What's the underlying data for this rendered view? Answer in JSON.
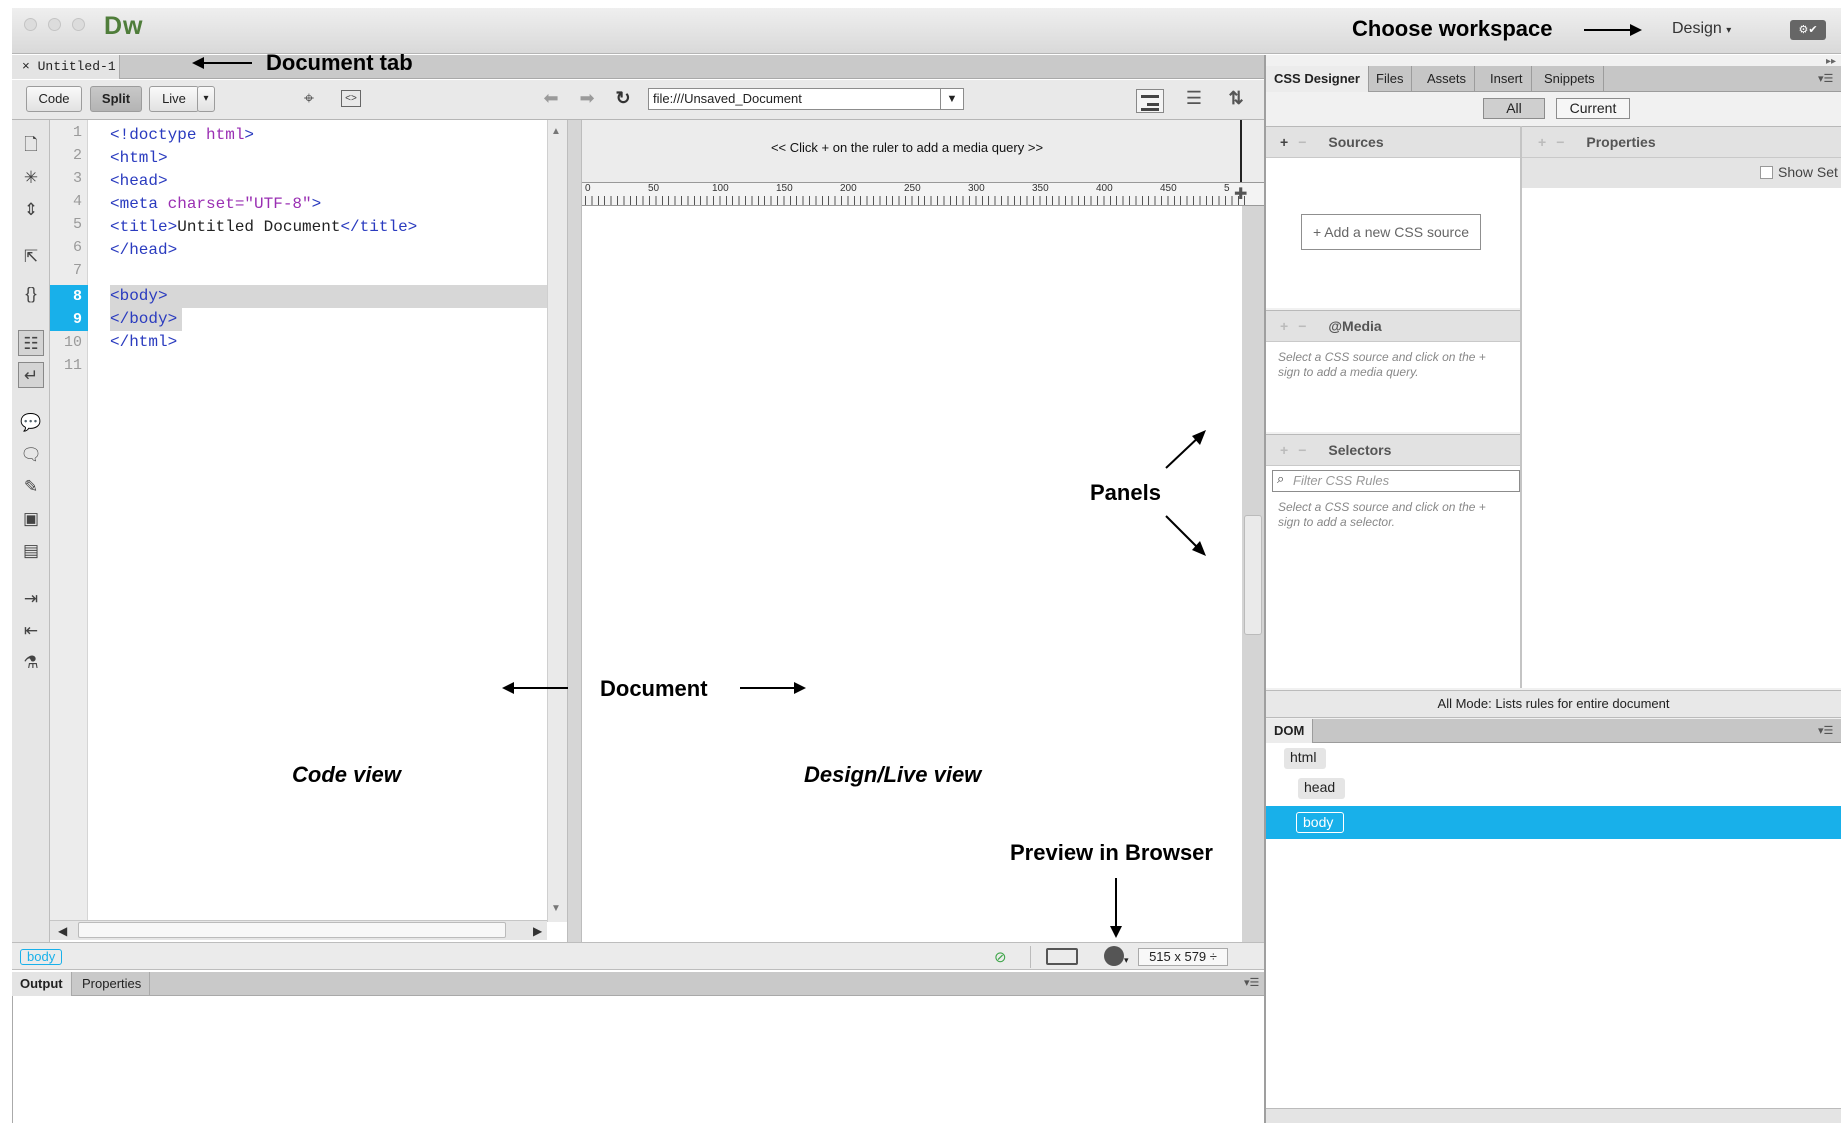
{
  "app": {
    "logo": "Dw",
    "workspace_label": "Design",
    "workspace_caret": "▾"
  },
  "annotations": {
    "choose_workspace": "Choose workspace",
    "document_tab": "Document tab",
    "panels": "Panels",
    "document": "Document",
    "code_view": "Code view",
    "design_live_view": "Design/Live view",
    "preview_in_browser": "Preview in Browser"
  },
  "document_tab": {
    "close": "×",
    "title": "Untitled-1"
  },
  "toolbar": {
    "code_label": "Code",
    "split_label": "Split",
    "live_label": "Live",
    "address": "file:///Unsaved_Document"
  },
  "code": {
    "line_numbers": [
      "1",
      "2",
      "3",
      "4",
      "5",
      "6",
      "7",
      "8",
      "9",
      "10",
      "11"
    ],
    "selected_lines": [
      "8",
      "9"
    ]
  },
  "design": {
    "media_query_hint": "<< Click + on the ruler to add a media query >>",
    "ruler_ticks": [
      "0",
      "50",
      "100",
      "150",
      "200",
      "250",
      "300",
      "350",
      "400",
      "450",
      "5"
    ]
  },
  "status": {
    "tag": "body",
    "window_size": "515 x 579 ÷"
  },
  "output_panel": {
    "tabs": [
      "Output",
      "Properties"
    ]
  },
  "right_panel": {
    "tabs": [
      "CSS Designer",
      "Files",
      "Assets",
      "Insert",
      "Snippets"
    ],
    "active_tab": "CSS Designer",
    "filter_buttons": [
      "All",
      "Current"
    ],
    "sources_header": "Sources",
    "properties_header": "Properties",
    "show_set_label": "Show Set",
    "add_source": "+ Add a new CSS source",
    "media_header": "@Media",
    "media_hint": "Select a CSS source and click on the + sign to add a media query.",
    "selectors_header": "Selectors",
    "filter_placeholder": "Filter CSS Rules",
    "selectors_hint": "Select a CSS source and click on the + sign to add a selector.",
    "all_mode": "All Mode: Lists rules for entire document",
    "dom_tab": "DOM",
    "dom_nodes": [
      "html",
      "head",
      "body"
    ]
  }
}
